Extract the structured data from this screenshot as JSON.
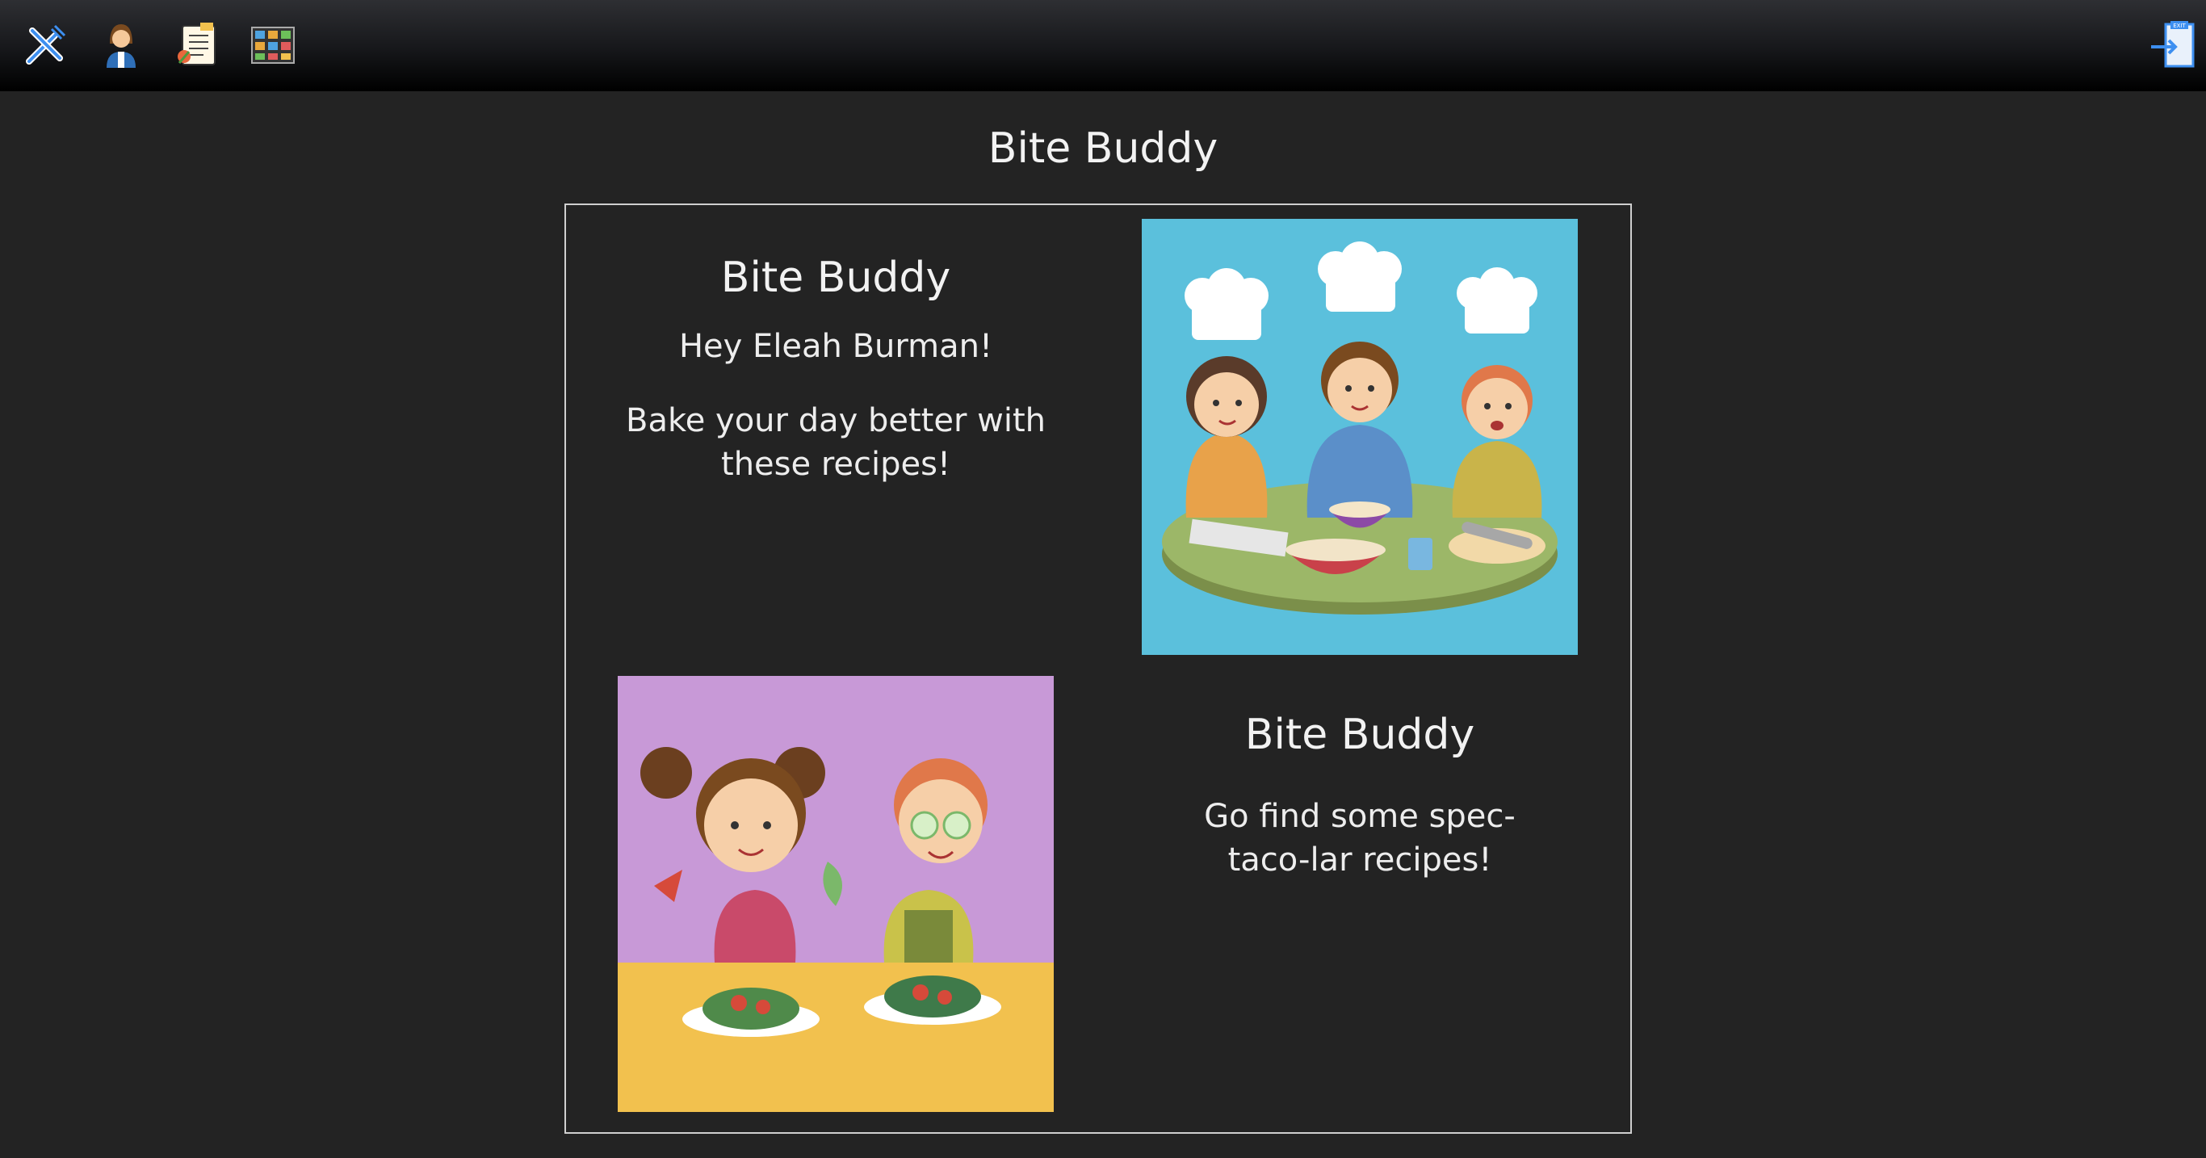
{
  "nav": {
    "icons": [
      "utensils-icon",
      "profile-icon",
      "recipe-list-icon",
      "recipe-grid-icon"
    ],
    "exit_icon": "exit-icon",
    "exit_label": "EXIT"
  },
  "page": {
    "title": "Bite Buddy"
  },
  "card_top": {
    "title": "Bite Buddy",
    "greeting": "Hey Eleah Burman!",
    "message": "Bake your day better with these recipes!"
  },
  "card_bottom": {
    "title": "Bite Buddy",
    "message": "Go find some spec-taco-lar recipes!"
  },
  "colors": {
    "background": "#232323",
    "accent_blue": "#3d8ff0",
    "image1_bg": "#5bc0dc",
    "image2_bg": "#c899d7",
    "image2_table": "#f2c14e"
  }
}
